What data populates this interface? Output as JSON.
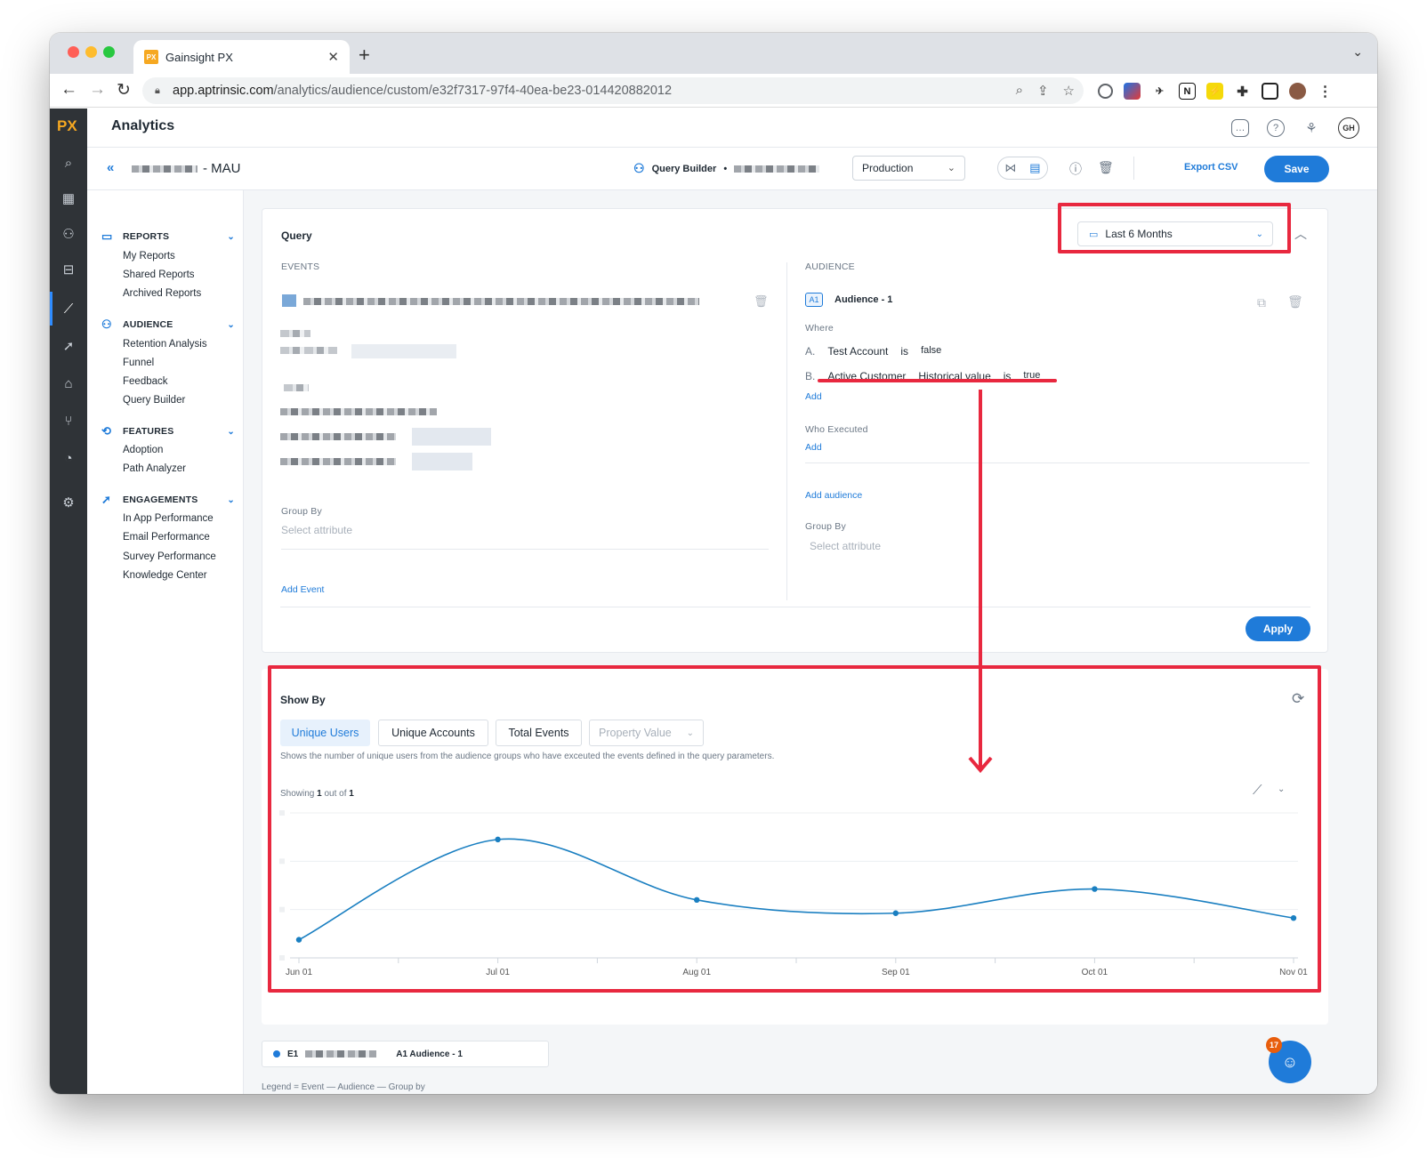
{
  "browser": {
    "tab_title": "Gainsight PX",
    "tab_favicon": "PX",
    "url_host": "app.aptrinsic.com",
    "url_path": "/analytics/audience/custom/e32f7317-97f4-40ea-be23-014420882012"
  },
  "app": {
    "logo": "PX",
    "title": "Analytics",
    "user_initials": "GH"
  },
  "toolbar": {
    "report_suffix": "- MAU",
    "query_builder_label": "Query Builder",
    "environment": "Production",
    "export_label": "Export CSV",
    "save_label": "Save"
  },
  "sidebar": {
    "sections": [
      {
        "title": "REPORTS",
        "items": [
          "My Reports",
          "Shared Reports",
          "Archived Reports"
        ]
      },
      {
        "title": "AUDIENCE",
        "items": [
          "Retention Analysis",
          "Funnel",
          "Feedback",
          "Query Builder"
        ]
      },
      {
        "title": "FEATURES",
        "items": [
          "Adoption",
          "Path Analyzer"
        ]
      },
      {
        "title": "ENGAGEMENTS",
        "items": [
          "In App Performance",
          "Email Performance",
          "Survey Performance",
          "Knowledge Center"
        ]
      }
    ]
  },
  "query": {
    "title": "Query",
    "date_range": "Last 6 Months",
    "events_label": "EVENTS",
    "group_by_label": "Group By",
    "group_by_placeholder": "Select attribute",
    "add_event": "Add Event",
    "audience_label": "AUDIENCE",
    "audience_chip": "A1",
    "audience_name": "Audience - 1",
    "where_label": "Where",
    "conditions": [
      {
        "letter": "A.",
        "field": "Test Account",
        "qualifier": "",
        "op": "is",
        "value": "false"
      },
      {
        "letter": "B.",
        "field": "Active Customer",
        "qualifier": "Historical value",
        "op": "is",
        "value": "true"
      }
    ],
    "add_label": "Add",
    "who_executed_label": "Who Executed",
    "add_audience": "Add audience",
    "audience_group_by_label": "Group By",
    "audience_group_by_placeholder": "Select attribute",
    "apply_label": "Apply"
  },
  "show_by": {
    "title": "Show By",
    "tabs": [
      "Unique Users",
      "Unique Accounts",
      "Total Events",
      "Property Value"
    ],
    "active_tab": "Unique Users",
    "description": "Shows the number of unique users from the audience groups who have exceuted the events defined in the query parameters.",
    "showing_prefix": "Showing",
    "showing_count": "1",
    "showing_mid": "out of",
    "showing_total": "1"
  },
  "chart_data": {
    "type": "line",
    "x": [
      "Jun 01",
      "Jul 01",
      "Aug 01",
      "Sep 01",
      "Oct 01",
      "Nov 01"
    ],
    "series": [
      {
        "values": [
          0.15,
          0.98,
          0.48,
          0.37,
          0.57,
          0.33
        ]
      }
    ],
    "ylim": [
      0,
      1.2
    ],
    "grid": true,
    "line_color": "#1a7fc1"
  },
  "legend": {
    "event_chip": "E1",
    "audience_chip": "A1 Audience - 1",
    "note": "Legend = Event — Audience — Group by"
  },
  "assistant": {
    "badge_count": "17"
  },
  "colors": {
    "accent": "#1f7bd9",
    "highlight": "#e8283f",
    "rail": "#2f3337"
  }
}
